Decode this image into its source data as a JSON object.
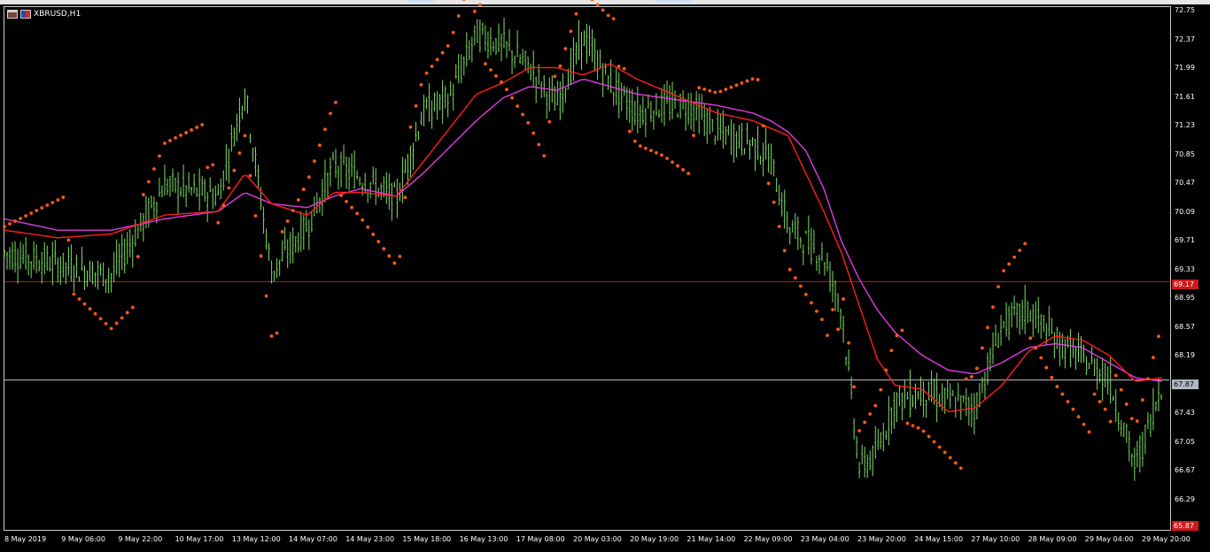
{
  "window": {
    "symbol": "XBRUSD,H1"
  },
  "colors": {
    "background": "#000000",
    "candles": "#7ddc62",
    "fast_ma": "#ff1e1e",
    "slow_ma": "#e03ce0",
    "parabolic_sar": "#ff5a14",
    "level_line_1": "#cc1a1a",
    "level_line_2": "#b0b7c2"
  },
  "icons": [
    "chart-window-icon",
    "symbol-flag-icon"
  ],
  "price_axis": [
    "72.75",
    "72.37",
    "71.99",
    "71.61",
    "71.23",
    "70.85",
    "70.47",
    "70.09",
    "69.71",
    "69.33",
    "68.95",
    "68.57",
    "68.19",
    "67.81",
    "67.43",
    "67.05",
    "66.67",
    "66.29"
  ],
  "time_axis": [
    "8 May 2019",
    "9 May 06:00",
    "9 May 22:00",
    "10 May 17:00",
    "13 May 12:00",
    "14 May 07:00",
    "14 May 23:00",
    "15 May 18:00",
    "16 May 13:00",
    "17 May 08:00",
    "20 May 03:00",
    "20 May 19:00",
    "21 May 14:00",
    "22 May 09:00",
    "23 May 04:00",
    "23 May 20:00",
    "24 May 15:00",
    "27 May 10:00",
    "28 May 09:00",
    "29 May 04:00",
    "29 May 20:00"
  ],
  "tags": {
    "level_1": "69.17",
    "current": "67.87",
    "bottom": "65.87"
  },
  "chart_data": {
    "type": "line",
    "symbol": "XBRUSD",
    "timeframe": "H1",
    "ylim": [
      65.9,
      72.8
    ],
    "x": [
      0,
      60,
      120,
      180,
      240,
      270,
      300,
      340,
      370,
      400,
      440,
      470,
      500,
      530,
      560,
      590,
      620,
      650,
      680,
      710,
      740,
      770,
      800,
      840,
      860,
      880,
      900,
      920,
      940,
      960,
      980,
      1000,
      1030,
      1060,
      1090,
      1120,
      1150,
      1180,
      1210,
      1240,
      1270,
      1300
    ],
    "series": [
      {
        "key": "price",
        "values": [
          69.55,
          69.4,
          69.25,
          70.45,
          70.3,
          71.7,
          69.3,
          69.9,
          70.7,
          70.55,
          70.25,
          71.4,
          71.6,
          72.45,
          72.3,
          72.0,
          71.5,
          72.4,
          71.8,
          71.4,
          71.5,
          71.5,
          71.15,
          71.0,
          70.8,
          69.9,
          69.7,
          69.5,
          68.8,
          66.7,
          66.9,
          67.6,
          67.7,
          67.6,
          67.5,
          68.6,
          68.8,
          68.4,
          68.15,
          67.9,
          66.7,
          67.85
        ]
      },
      {
        "key": "fast_ma",
        "values": [
          69.85,
          69.75,
          69.8,
          70.05,
          70.1,
          70.6,
          70.2,
          70.05,
          70.35,
          70.35,
          70.3,
          70.75,
          71.2,
          71.65,
          71.8,
          72.0,
          72.0,
          71.9,
          72.05,
          71.85,
          71.7,
          71.55,
          71.4,
          71.3,
          71.2,
          71.1,
          70.6,
          70.1,
          69.55,
          68.85,
          68.15,
          67.8,
          67.75,
          67.45,
          67.5,
          67.8,
          68.25,
          68.45,
          68.4,
          68.2,
          67.85,
          67.9
        ]
      },
      {
        "key": "slow_ma",
        "values": [
          70.0,
          69.85,
          69.85,
          70.0,
          70.1,
          70.35,
          70.2,
          70.15,
          70.3,
          70.4,
          70.3,
          70.6,
          70.95,
          71.3,
          71.6,
          71.75,
          71.7,
          71.85,
          71.75,
          71.65,
          71.6,
          71.55,
          71.5,
          71.4,
          71.3,
          71.15,
          70.9,
          70.4,
          69.7,
          69.2,
          68.8,
          68.5,
          68.2,
          68.0,
          67.95,
          68.1,
          68.3,
          68.35,
          68.3,
          68.1,
          67.9,
          67.85
        ]
      }
    ]
  }
}
